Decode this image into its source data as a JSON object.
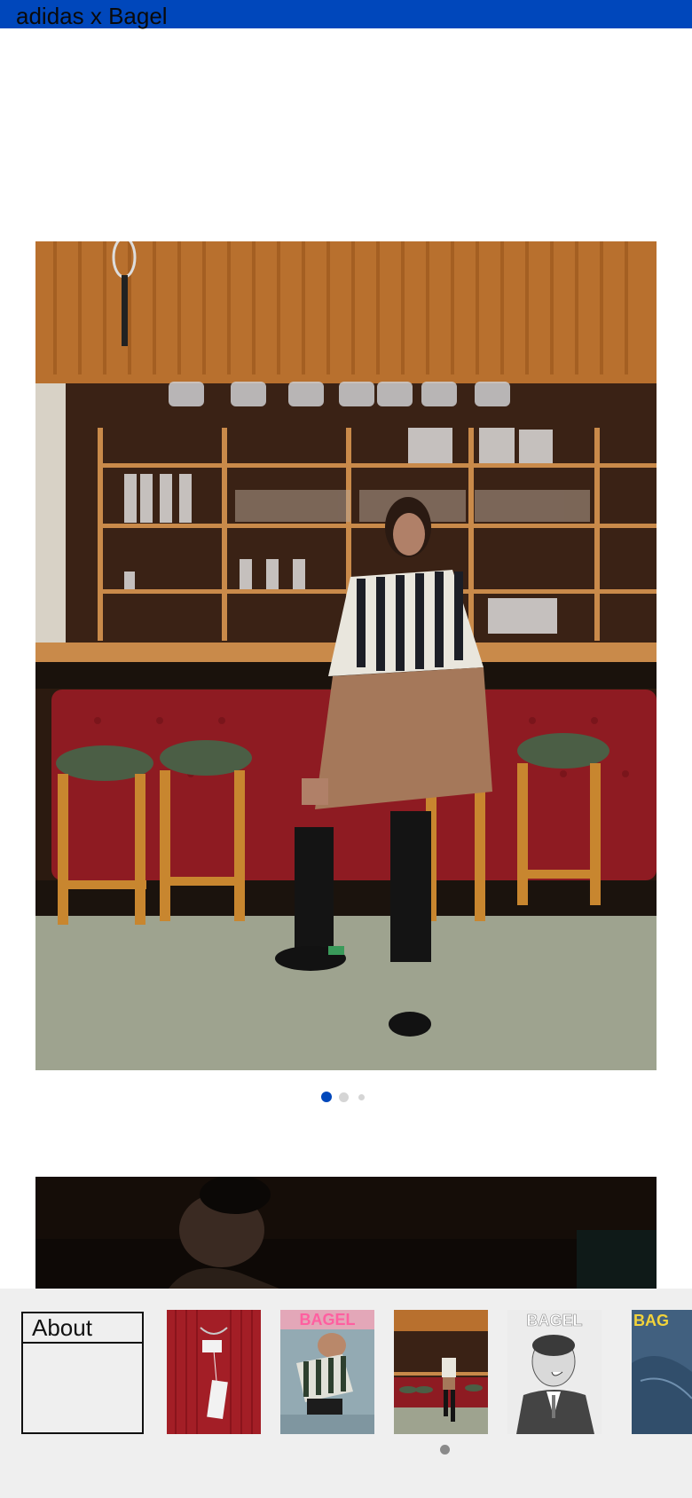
{
  "header": {
    "title": "adidas x Bagel",
    "bar_color": "#0047bb"
  },
  "carousel": {
    "slides": [
      {
        "icon": "bar-stool-photo"
      },
      {
        "icon": "dark-portrait-photo"
      },
      {
        "icon": "photo"
      }
    ],
    "active_index": 0,
    "dot_active_color": "#0047bb",
    "dot_inactive_color": "#d5d5d5"
  },
  "tray": {
    "about_label": "About",
    "thumbnails": [
      {
        "name": "red-knit-tag-thumbnail",
        "icon": "product-photo"
      },
      {
        "name": "bagel-cover-green-stripe-thumbnail",
        "icon": "magazine-cover",
        "cover_text": "BAGEL"
      },
      {
        "name": "bar-stool-thumbnail",
        "icon": "photo"
      },
      {
        "name": "bagel-cover-portrait-thumbnail",
        "icon": "magazine-cover",
        "cover_text": "BAGEL"
      },
      {
        "name": "bagel-cover-blue-thumbnail",
        "icon": "magazine-cover",
        "cover_text": "BAG"
      }
    ],
    "background": "#efefef"
  }
}
